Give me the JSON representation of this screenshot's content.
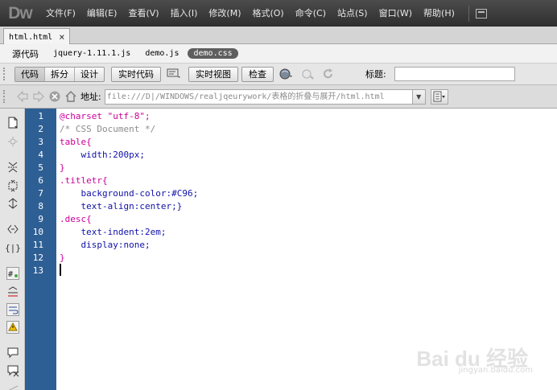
{
  "app": {
    "logo": "Dw"
  },
  "menu": [
    "文件(F)",
    "编辑(E)",
    "查看(V)",
    "插入(I)",
    "修改(M)",
    "格式(O)",
    "命令(C)",
    "站点(S)",
    "窗口(W)",
    "帮助(H)"
  ],
  "doc_tab": {
    "label": "html.html",
    "close": "×"
  },
  "related_files": {
    "source": "源代码",
    "files": [
      "jquery-1.11.1.js",
      "demo.js"
    ],
    "active_file": "demo.css"
  },
  "view_toolbar": {
    "code": "代码",
    "split": "拆分",
    "design": "设计",
    "live_code": "实时代码",
    "live_view": "实时视图",
    "inspect": "检查",
    "title_label": "标题:",
    "title_value": ""
  },
  "nav_bar": {
    "address_label": "地址:",
    "address_value": "file:///D|/WINDOWS/realjqeurywork/表格的折叠与展开/html.html"
  },
  "code": {
    "line_numbers": [
      "1",
      "2",
      "3",
      "4",
      "5",
      "6",
      "7",
      "8",
      "9",
      "10",
      "11",
      "12",
      "13"
    ],
    "lines": [
      "@charset \"utf-8\";",
      "/* CSS Document */",
      "table{",
      "    width:200px;",
      "}",
      ".titletr{",
      "    background-color:#C96;",
      "    text-align:center;}",
      ".desc{",
      "    text-indent:2em;",
      "    display:none;",
      "}",
      ""
    ]
  },
  "watermark": {
    "brand": "Bai du 经验",
    "url": "jingyan.baidu.com"
  },
  "colors": {
    "gutter": "#2e5f94",
    "menubar": "#3a3a3a",
    "css_selector": "#cc0099",
    "css_property": "#1010a8"
  }
}
